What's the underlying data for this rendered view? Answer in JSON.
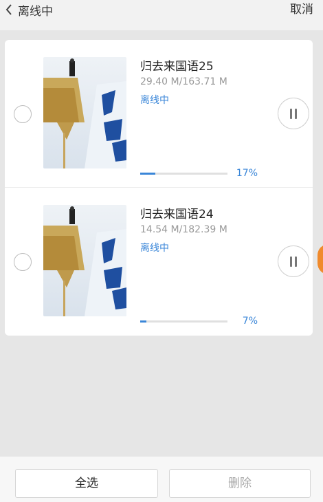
{
  "header": {
    "title": "离线中",
    "cancel_label": "取消"
  },
  "items": [
    {
      "title": "归去来国语25",
      "size": "29.40 M/163.71 M",
      "status": "离线中",
      "progress_percent": 17,
      "progress_label": "17%"
    },
    {
      "title": "归去来国语24",
      "size": "14.54 M/182.39 M",
      "status": "离线中",
      "progress_percent": 7,
      "progress_label": "7%"
    }
  ],
  "footer": {
    "select_all_label": "全选",
    "delete_label": "删除"
  },
  "colors": {
    "accent": "#3a86d8",
    "orange": "#f08a2c"
  }
}
